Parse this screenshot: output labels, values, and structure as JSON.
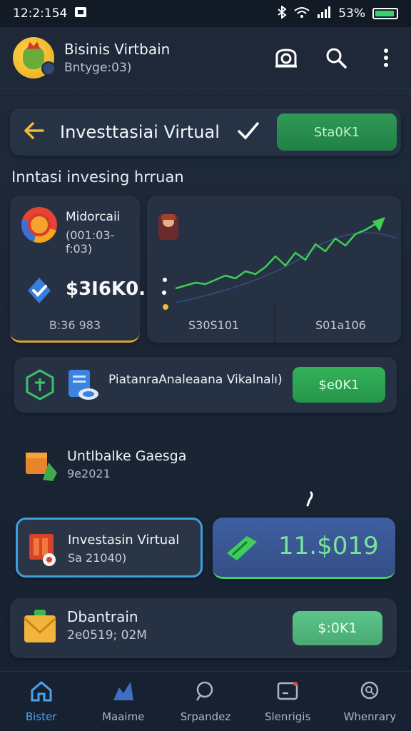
{
  "status_bar": {
    "time": "12:2:154",
    "battery_text": "53%"
  },
  "app_bar": {
    "title": "Bisinis Virtbain",
    "subtitle": "Bntyge:03)"
  },
  "header": {
    "title": "Investtasiai Virtual",
    "button_label": "Sta0K1"
  },
  "section_label": "Inntasi invesing hrruan",
  "card_left": {
    "title": "Midorcaii",
    "subtitle": "(001:03-f:03)",
    "value": "$3I6K0.",
    "footer": "B:36 983"
  },
  "card_chart": {
    "foot_left": "S30S101",
    "foot_right": "S01a106",
    "chart_data": {
      "type": "line",
      "title": "",
      "xlabel": "",
      "ylabel": "",
      "x": [
        0,
        1,
        2,
        3,
        4,
        5,
        6,
        7,
        8,
        9,
        10,
        11,
        12,
        13,
        14,
        15,
        16,
        17,
        18,
        19,
        20
      ],
      "series": [
        {
          "values": [
            10,
            14,
            18,
            16,
            22,
            28,
            24,
            34,
            30,
            40,
            55,
            42,
            60,
            50,
            72,
            62,
            80,
            70,
            86,
            92,
            100
          ]
        }
      ],
      "ylim": [
        0,
        110
      ],
      "grid": false,
      "line_color": "#3ecf52"
    }
  },
  "row_card": {
    "text": "PiatanraAnaleaana Vikalnalı)",
    "button_label": "$e0K1"
  },
  "plain_item": {
    "title": "Untlbalke Gaesga",
    "subtitle": "9e2021"
  },
  "invest_card": {
    "title": "Investasin Virtual",
    "subtitle": "Sa 21040)"
  },
  "value_card": {
    "value": "11.$019"
  },
  "db_card": {
    "title": "Dbantrain",
    "subtitle": "2e0519; 02M",
    "button_label": "$:0K1"
  },
  "bottom_nav": [
    {
      "label": "Bister",
      "icon": "home-icon"
    },
    {
      "label": "Maaime",
      "icon": "chart-icon"
    },
    {
      "label": "Srpandez",
      "icon": "search-icon"
    },
    {
      "label": "Slenrigis",
      "icon": "notification-icon"
    },
    {
      "label": "Whenrary",
      "icon": "magnify-icon"
    }
  ],
  "colors": {
    "accent_green": "#2f9a55",
    "accent_blue": "#4aa3f0",
    "highlight_gold": "#e0a22e"
  }
}
